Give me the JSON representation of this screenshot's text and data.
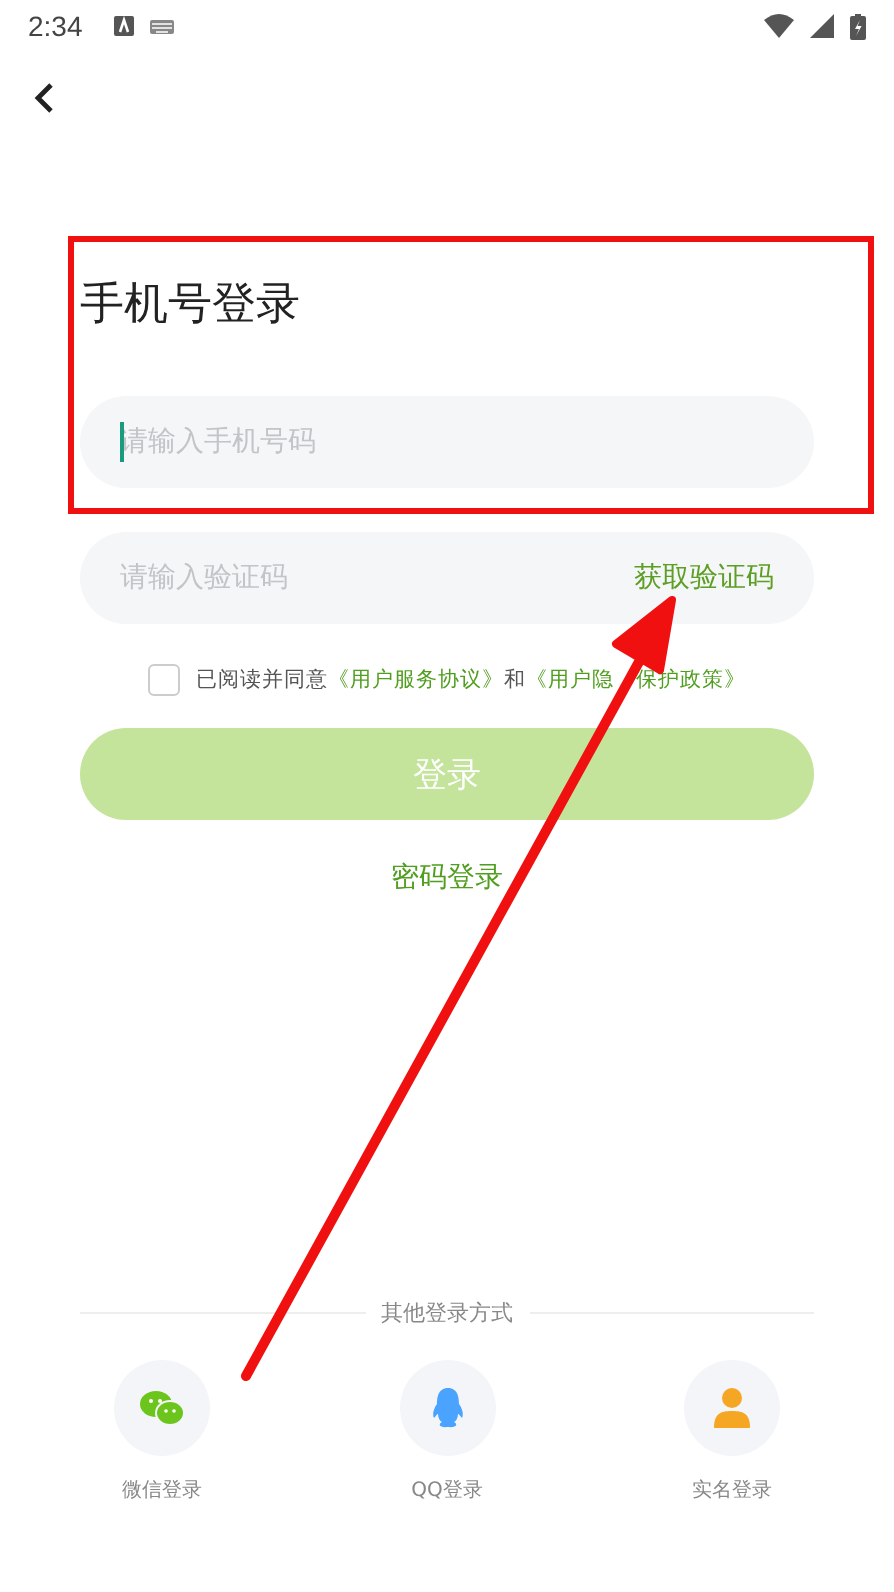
{
  "status_bar": {
    "time": "2:34"
  },
  "title": "手机号登录",
  "phone_field": {
    "placeholder": "请输入手机号码",
    "focused": true
  },
  "code_field": {
    "placeholder": "请输入验证码",
    "action": "获取验证码"
  },
  "agreement": {
    "checked": false,
    "prefix": "已阅读并同意",
    "link_1": "《用户服务协议》",
    "joiner": "和",
    "link_2": "《用户隐",
    "link_2_rest": "保护政策》"
  },
  "login_button": {
    "label": "登录",
    "disabled": true
  },
  "password_login": "密码登录",
  "other_methods": {
    "heading": "其他登录方式",
    "items": [
      {
        "kind": "wechat",
        "label": "微信登录"
      },
      {
        "kind": "qq",
        "label": "QQ登录"
      },
      {
        "kind": "person",
        "label": "实名登录"
      }
    ]
  },
  "annotation": {
    "highlight_box": true,
    "arrow": true
  }
}
